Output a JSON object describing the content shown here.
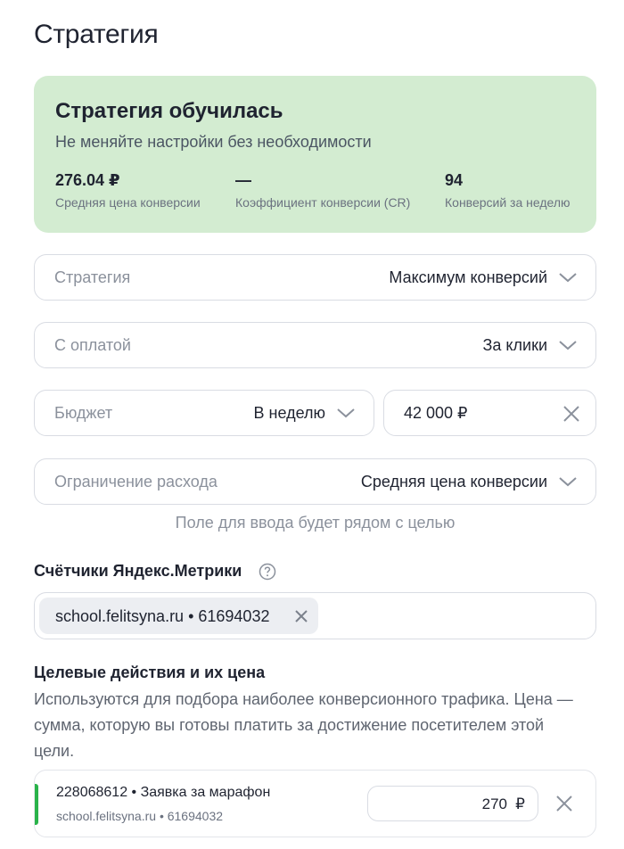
{
  "page": {
    "title": "Стратегия"
  },
  "status": {
    "title": "Стратегия обучилась",
    "subtitle": "Не меняйте настройки без необходимости",
    "metrics": [
      {
        "value": "276.04 ₽",
        "label": "Средняя цена конверсии"
      },
      {
        "value": "—",
        "label": "Коэффициент конверсии (CR)"
      },
      {
        "value": "94",
        "label": "Конверсий за неделю"
      }
    ],
    "background_color": "#d3ecd1"
  },
  "fields": {
    "strategy": {
      "label": "Стратегия",
      "value": "Максимум конверсий"
    },
    "payment": {
      "label": "С оплатой",
      "value": "За клики"
    },
    "budget": {
      "label": "Бюджет",
      "value": "В неделю"
    },
    "budget_amount": {
      "value": "42 000 ₽"
    },
    "spend_limit": {
      "label": "Ограничение расхода",
      "value": "Средняя цена конверсии"
    }
  },
  "hint": "Поле для ввода будет рядом с целью",
  "metrika": {
    "title": "Счётчики Яндекс.Метрики",
    "chip": "school.felitsyna.ru • 61694032"
  },
  "goals": {
    "title": "Целевые действия и их цена",
    "description": "Используются для подбора наиболее конверсионного трафика. Цена — сумма, которую вы готовы платить за достижение посетителем этой цели.",
    "items": [
      {
        "title": "228068612 • Заявка за марафон",
        "subtitle": "school.felitsyna.ru • 61694032",
        "price": "270",
        "currency": "₽",
        "accent_color": "#29b34a"
      }
    ]
  },
  "icons": {
    "chevron": "chevron-down-icon",
    "clear": "close-icon",
    "help": "question-circle-icon"
  }
}
